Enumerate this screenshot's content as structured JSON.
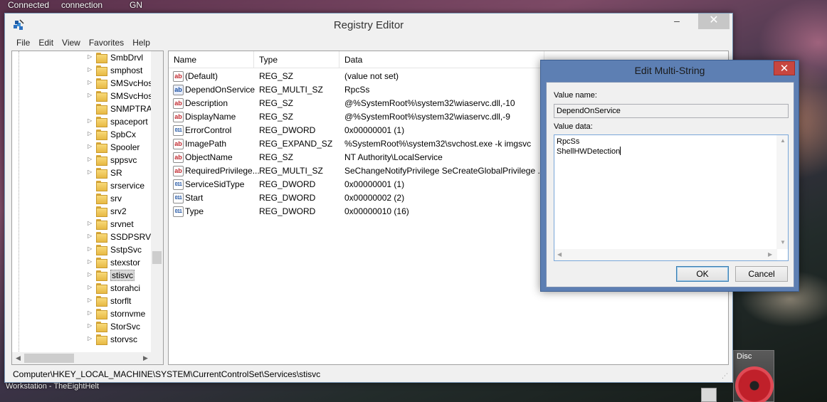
{
  "desktop": {
    "top_texts": [
      "Connected",
      "connection",
      "GN"
    ],
    "bottom_text": "Workstation - TheEightHelt",
    "disc_label": "Disc"
  },
  "window": {
    "title": "Registry Editor",
    "controls": {
      "minimize": "–",
      "close": "✕"
    }
  },
  "menu": [
    "File",
    "Edit",
    "View",
    "Favorites",
    "Help"
  ],
  "tree": {
    "items": [
      {
        "label": "SmbDrvl",
        "expandable": true
      },
      {
        "label": "smphost",
        "expandable": true
      },
      {
        "label": "SMSvcHost",
        "expandable": true
      },
      {
        "label": "SMSvcHost",
        "expandable": true
      },
      {
        "label": "SNMPTRAP",
        "expandable": false
      },
      {
        "label": "spaceport",
        "expandable": true
      },
      {
        "label": "SpbCx",
        "expandable": true
      },
      {
        "label": "Spooler",
        "expandable": true
      },
      {
        "label": "sppsvc",
        "expandable": true
      },
      {
        "label": "SR",
        "expandable": true
      },
      {
        "label": "srservice",
        "expandable": false
      },
      {
        "label": "srv",
        "expandable": false
      },
      {
        "label": "srv2",
        "expandable": false
      },
      {
        "label": "srvnet",
        "expandable": true
      },
      {
        "label": "SSDPSRV",
        "expandable": true
      },
      {
        "label": "SstpSvc",
        "expandable": true
      },
      {
        "label": "stexstor",
        "expandable": true
      },
      {
        "label": "stisvc",
        "expandable": true,
        "selected": true
      },
      {
        "label": "storahci",
        "expandable": true
      },
      {
        "label": "storflt",
        "expandable": true
      },
      {
        "label": "stornvme",
        "expandable": true
      },
      {
        "label": "StorSvc",
        "expandable": true
      },
      {
        "label": "storvsc",
        "expandable": true
      }
    ]
  },
  "list": {
    "columns": [
      "Name",
      "Type",
      "Data"
    ],
    "rows": [
      {
        "name": "(Default)",
        "type": "REG_SZ",
        "data": "(value not set)",
        "icon": "ab-icon"
      },
      {
        "name": "DependOnService",
        "type": "REG_MULTI_SZ",
        "data": "RpcSs",
        "icon": "ab-icon"
      },
      {
        "name": "Description",
        "type": "REG_SZ",
        "data": "@%SystemRoot%\\system32\\wiaservc.dll,-10",
        "icon": "ab-icon"
      },
      {
        "name": "DisplayName",
        "type": "REG_SZ",
        "data": "@%SystemRoot%\\system32\\wiaservc.dll,-9",
        "icon": "ab-icon"
      },
      {
        "name": "ErrorControl",
        "type": "REG_DWORD",
        "data": "0x00000001 (1)",
        "icon": "binary-icon"
      },
      {
        "name": "ImagePath",
        "type": "REG_EXPAND_SZ",
        "data": "%SystemRoot%\\system32\\svchost.exe -k imgsvc",
        "icon": "ab-icon"
      },
      {
        "name": "ObjectName",
        "type": "REG_SZ",
        "data": "NT Authority\\LocalService",
        "icon": "ab-icon"
      },
      {
        "name": "RequiredPrivilege...",
        "type": "REG_MULTI_SZ",
        "data": "SeChangeNotifyPrivilege SeCreateGlobalPrivilege ...",
        "icon": "ab-icon"
      },
      {
        "name": "ServiceSidType",
        "type": "REG_DWORD",
        "data": "0x00000001 (1)",
        "icon": "binary-icon"
      },
      {
        "name": "Start",
        "type": "REG_DWORD",
        "data": "0x00000002 (2)",
        "icon": "binary-icon"
      },
      {
        "name": "Type",
        "type": "REG_DWORD",
        "data": "0x00000010 (16)",
        "icon": "binary-icon"
      }
    ]
  },
  "status": "Computer\\HKEY_LOCAL_MACHINE\\SYSTEM\\CurrentControlSet\\Services\\stisvc",
  "dialog": {
    "title": "Edit Multi-String",
    "close": "✕",
    "value_name_label": "Value name:",
    "value_name": "DependOnService",
    "value_data_label": "Value data:",
    "value_data_lines": [
      "RpcSs",
      "ShellHWDetection"
    ],
    "ok": "OK",
    "cancel": "Cancel"
  }
}
